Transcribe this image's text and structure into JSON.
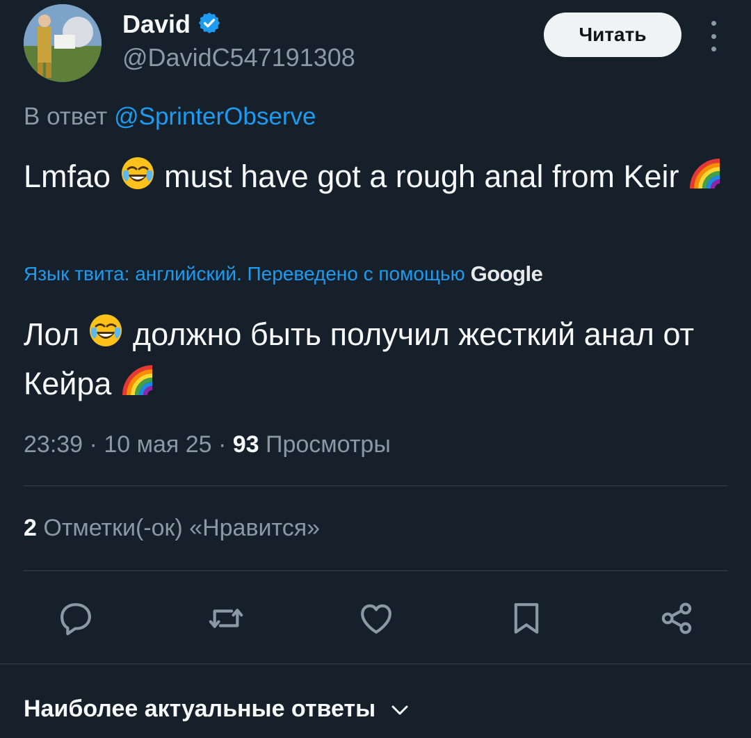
{
  "author": {
    "name": "David",
    "handle": "@DavidC547191308",
    "verified": true
  },
  "follow_button": {
    "label": "Читать"
  },
  "more_icon": "more-vertical-icon",
  "reply": {
    "prefix": "В ответ",
    "mention": "@SprinterObserve"
  },
  "tweet": {
    "part1": "Lmfao",
    "part2": "must have got a rough anal from Keir",
    "emojis": [
      "face-with-tears-of-joy-icon",
      "rainbow-icon"
    ]
  },
  "translation": {
    "note": "Язык твита: английский. Переведено с помощью",
    "provider": "Google",
    "part1": "Лол",
    "part2": "должно быть получил жесткий анал от Кейра"
  },
  "meta": {
    "time": "23:39",
    "date": "10 мая 25",
    "views_count": "93",
    "views_label": "Просмотры",
    "separator": " · "
  },
  "likes": {
    "count": "2",
    "label": "Отметки(-ок) «Нравится»"
  },
  "actions": [
    "reply-icon",
    "retweet-icon",
    "like-icon",
    "bookmark-icon",
    "share-icon"
  ],
  "answers": {
    "label": "Наиболее актуальные ответы"
  },
  "colors": {
    "background": "#15202b",
    "accent": "#1d9bf0",
    "muted": "#8b98a5",
    "text": "#f7f9f9"
  }
}
